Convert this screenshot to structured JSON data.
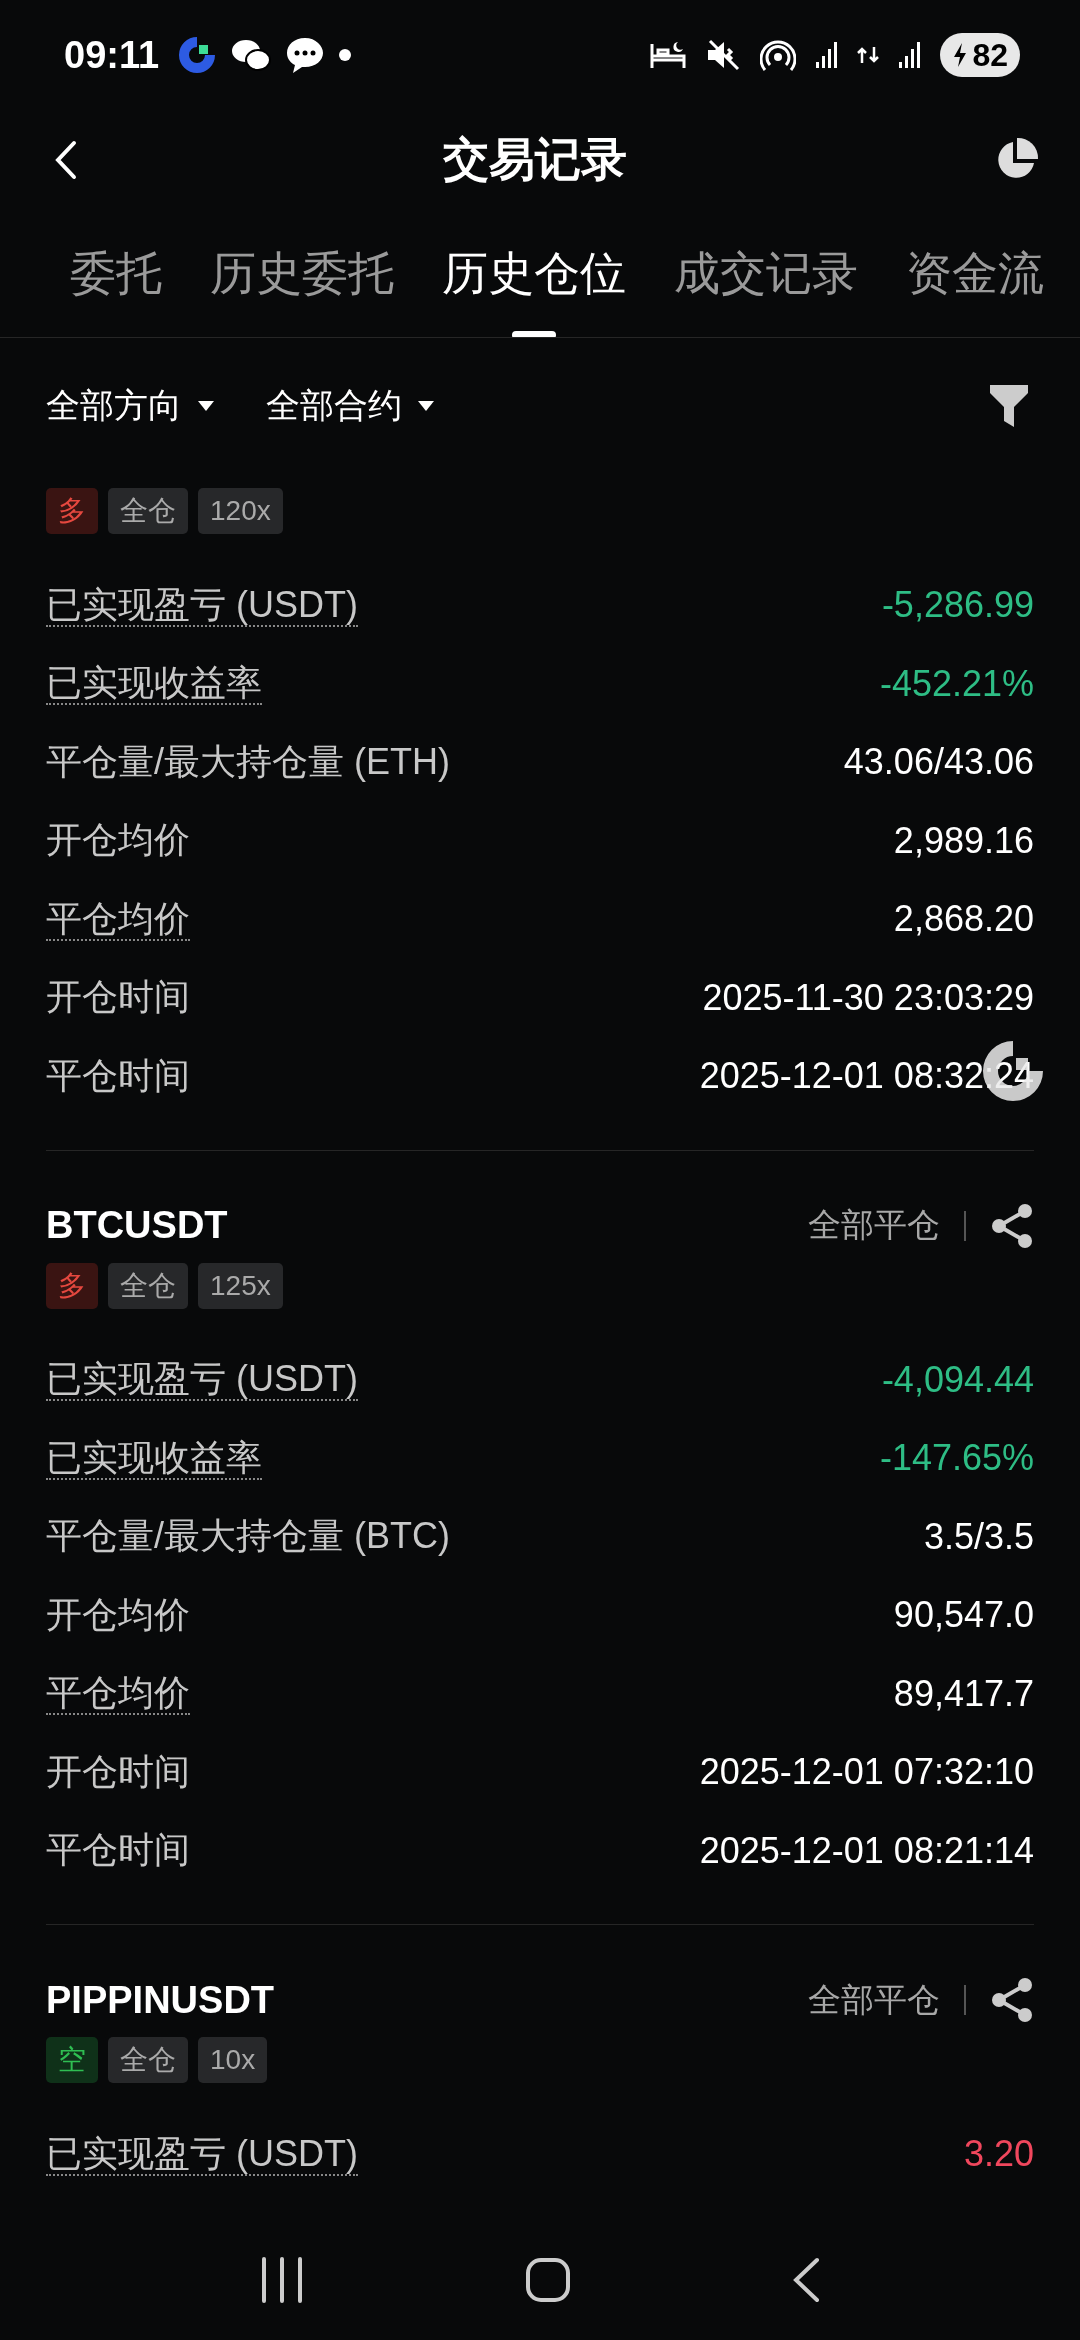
{
  "status_bar": {
    "time": "09:11",
    "battery": "82"
  },
  "header": {
    "title": "交易记录"
  },
  "tabs": [
    {
      "label": "委托",
      "selected": false
    },
    {
      "label": "历史委托",
      "selected": false
    },
    {
      "label": "历史仓位",
      "selected": true
    },
    {
      "label": "成交记录",
      "selected": false
    },
    {
      "label": "资金流",
      "selected": false
    }
  ],
  "filters": [
    {
      "label": "全部方向"
    },
    {
      "label": "全部合约"
    }
  ],
  "positions": [
    {
      "tags": [
        {
          "label": "多",
          "kind": "long"
        },
        {
          "label": "全仓",
          "kind": "plain"
        },
        {
          "label": "120x",
          "kind": "plain"
        }
      ],
      "rows": [
        {
          "label": "已实现盈亏 (USDT)",
          "value": "-5,286.99",
          "dotted": true,
          "kind": "loss"
        },
        {
          "label": "已实现收益率",
          "value": "-452.21%",
          "dotted": true,
          "kind": "loss"
        },
        {
          "label": "平仓量/最大持仓量 (ETH)",
          "value": "43.06/43.06",
          "dotted": false,
          "kind": "plain"
        },
        {
          "label": "开仓均价",
          "value": "2,989.16",
          "dotted": false,
          "kind": "plain"
        },
        {
          "label": "平仓均价",
          "value": "2,868.20",
          "dotted": true,
          "kind": "plain"
        },
        {
          "label": "开仓时间",
          "value": "2025-11-30 23:03:29",
          "dotted": false,
          "kind": "plain"
        },
        {
          "label": "平仓时间",
          "value": "2025-12-01 08:32:24",
          "dotted": false,
          "kind": "plain"
        }
      ]
    },
    {
      "symbol": "BTCUSDT",
      "close_type": "全部平仓",
      "tags": [
        {
          "label": "多",
          "kind": "long"
        },
        {
          "label": "全仓",
          "kind": "plain"
        },
        {
          "label": "125x",
          "kind": "plain"
        }
      ],
      "rows": [
        {
          "label": "已实现盈亏 (USDT)",
          "value": "-4,094.44",
          "dotted": true,
          "kind": "loss"
        },
        {
          "label": "已实现收益率",
          "value": "-147.65%",
          "dotted": true,
          "kind": "loss"
        },
        {
          "label": "平仓量/最大持仓量 (BTC)",
          "value": "3.5/3.5",
          "dotted": false,
          "kind": "plain"
        },
        {
          "label": "开仓均价",
          "value": "90,547.0",
          "dotted": false,
          "kind": "plain"
        },
        {
          "label": "平仓均价",
          "value": "89,417.7",
          "dotted": true,
          "kind": "plain"
        },
        {
          "label": "开仓时间",
          "value": "2025-12-01 07:32:10",
          "dotted": false,
          "kind": "plain"
        },
        {
          "label": "平仓时间",
          "value": "2025-12-01 08:21:14",
          "dotted": false,
          "kind": "plain"
        }
      ]
    },
    {
      "symbol": "PIPPINUSDT",
      "close_type": "全部平仓",
      "tags": [
        {
          "label": "空",
          "kind": "short"
        },
        {
          "label": "全仓",
          "kind": "plain"
        },
        {
          "label": "10x",
          "kind": "plain"
        }
      ],
      "rows": [
        {
          "label": "已实现盈亏 (USDT)",
          "value": "3.20",
          "dotted": true,
          "kind": "profit"
        }
      ]
    }
  ]
}
